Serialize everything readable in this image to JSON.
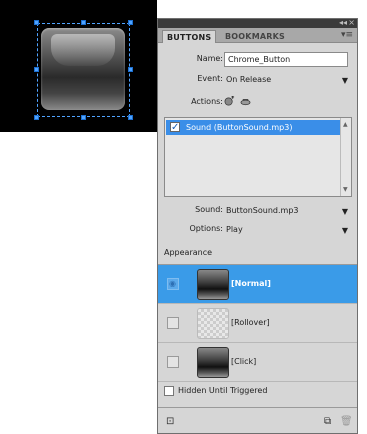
{
  "panel": {
    "tabs": [
      {
        "label": "BUTTONS",
        "active": true
      },
      {
        "label": "BOOKMARKS",
        "active": false
      }
    ],
    "titlebar_controls": {
      "collapse": "◂◂",
      "close": "×"
    },
    "panel_menu_icon": "panel-menu-icon"
  },
  "form": {
    "name_label": "Name:",
    "name_value": "Chrome_Button",
    "event_label": "Event:",
    "event_value": "On Release",
    "actions_label": "Actions:",
    "action_icons": [
      "add-action-icon",
      "delete-action-icon"
    ]
  },
  "actions_list": [
    {
      "label": "Sound (ButtonSound.mp3)",
      "checked": true,
      "selected": true
    }
  ],
  "sound": {
    "sound_label": "Sound:",
    "sound_value": "ButtonSound.mp3",
    "options_label": "Options:",
    "options_value": "Play"
  },
  "appearance": {
    "section_label": "Appearance",
    "states": [
      {
        "name": "[Normal]",
        "selected": true,
        "has_content": true
      },
      {
        "name": "[Rollover]",
        "selected": false,
        "has_content": false
      },
      {
        "name": "[Click]",
        "selected": false,
        "has_content": true
      }
    ]
  },
  "hidden_until_triggered": {
    "label": "Hidden Until Triggered",
    "checked": false
  },
  "colors": {
    "selection_blue": "#3a9be8",
    "panel_bg": "#d6d6d6",
    "canvas_bg": "#000000",
    "handle_blue": "#4fa3ff"
  }
}
